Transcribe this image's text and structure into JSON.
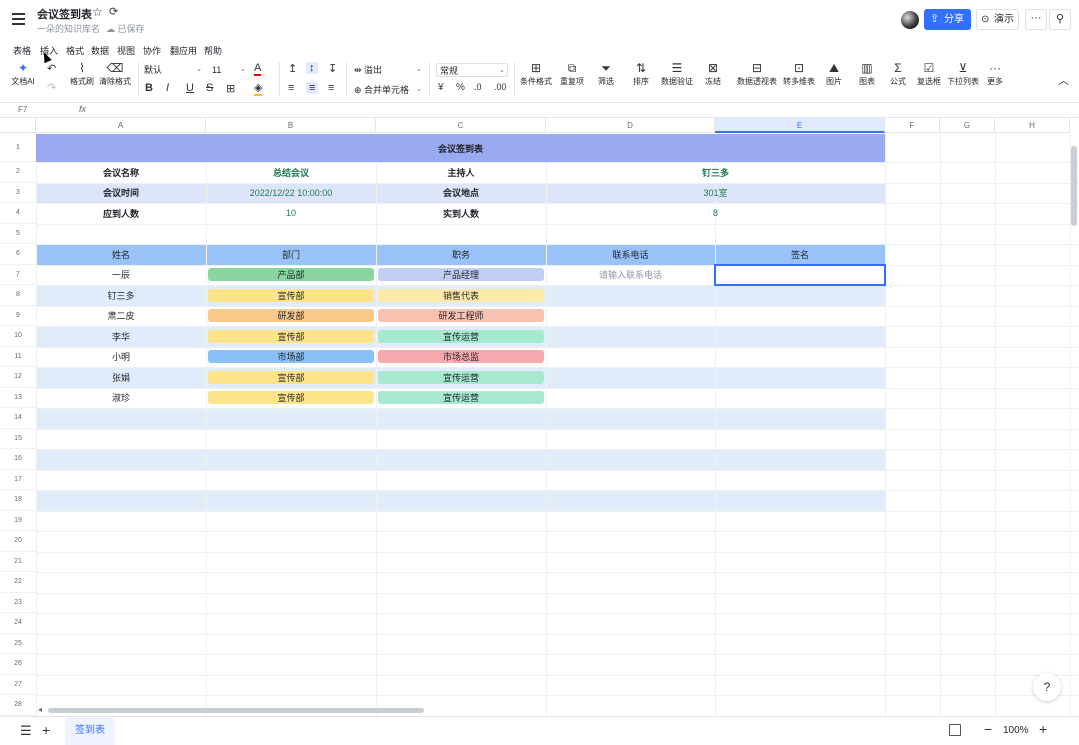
{
  "titlebar": {
    "title": "会议签到表",
    "path": "一朵的知识库名",
    "saved": "已保存",
    "share_label": "分享",
    "present_label": "演示",
    "more": "···"
  },
  "menubar": [
    "表格",
    "插入",
    "格式",
    "数据",
    "视图",
    "协作",
    "翻应用",
    "帮助"
  ],
  "toolbar": {
    "doc_ai": "文档AI",
    "format_painter": "格式刷",
    "clear_format": "清除格式",
    "font_name": "默认",
    "font_size": "11",
    "wrap": "溢出",
    "merge": "合并单元格",
    "number_format": "常规",
    "conditional_format": "条件格式",
    "duplicates": "重复项",
    "filter": "筛选",
    "sort": "排序",
    "validation": "数据验证",
    "freeze": "冻结",
    "pivot": "数据透视表",
    "multi_dim": "转多维表",
    "image": "图片",
    "chart": "图表",
    "formula": "公式",
    "checkbox": "复选框",
    "dropdown": "下拉列表",
    "more": "更多"
  },
  "formula_bar": {
    "cell_ref": "F7",
    "fx": "fx"
  },
  "columns": [
    "A",
    "B",
    "C",
    "D",
    "E",
    "F",
    "G",
    "H"
  ],
  "rows": [
    "1",
    "2",
    "3",
    "4",
    "5",
    "6",
    "7",
    "8",
    "9",
    "10",
    "11",
    "12",
    "13",
    "14",
    "15",
    "16",
    "17",
    "18",
    "19",
    "20",
    "21",
    "22",
    "23",
    "24",
    "25",
    "26",
    "27",
    "28"
  ],
  "sheet": {
    "title": "会议签到表",
    "info": {
      "name_label": "会议名称",
      "name_value": "总结会议",
      "host_label": "主持人",
      "host_value": "钉三多",
      "time_label": "会议时间",
      "time_value": "2022/12/22 10:00:00",
      "place_label": "会议地点",
      "place_value": "301室",
      "expected_label": "应到人数",
      "expected_value": "10",
      "actual_label": "实到人数",
      "actual_value": "8"
    },
    "headers": [
      "姓名",
      "部门",
      "职务",
      "联系电话",
      "签名"
    ],
    "records": [
      {
        "name": "一辰",
        "dept": "产品部",
        "dept_color": "#8ad6a0",
        "title": "产品经理",
        "title_color": "#c2cdf4",
        "phone": "请输入联系电话"
      },
      {
        "name": "钉三多",
        "dept": "宣传部",
        "dept_color": "#fde48a",
        "title": "销售代表",
        "title_color": "#fde9a8",
        "phone": ""
      },
      {
        "name": "肃二皮",
        "dept": "研发部",
        "dept_color": "#f9c98a",
        "title": "研发工程师",
        "title_color": "#f8c2b0",
        "phone": ""
      },
      {
        "name": "李华",
        "dept": "宣传部",
        "dept_color": "#fde48a",
        "title": "宣传运营",
        "title_color": "#a6e9cf",
        "phone": ""
      },
      {
        "name": "小明",
        "dept": "市场部",
        "dept_color": "#8ac0f5",
        "title": "市场总监",
        "title_color": "#f7a9b0",
        "phone": ""
      },
      {
        "name": "张娟",
        "dept": "宣传部",
        "dept_color": "#fde48a",
        "title": "宣传运营",
        "title_color": "#a6e9cf",
        "phone": ""
      },
      {
        "name": "淑珍",
        "dept": "宣传部",
        "dept_color": "#fde48a",
        "title": "宣传运营",
        "title_color": "#a6e9cf",
        "phone": ""
      }
    ]
  },
  "bottom": {
    "sheet_tab": "签到表",
    "zoom": "100%"
  }
}
